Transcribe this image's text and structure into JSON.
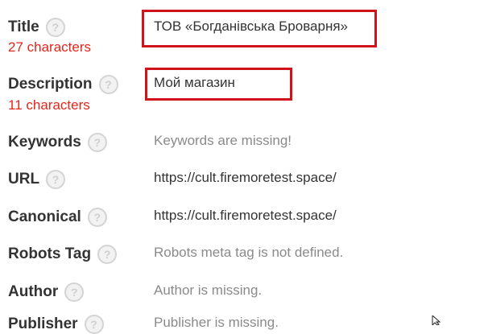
{
  "rows": [
    {
      "label": "Title",
      "count": "27 characters",
      "value": "ТОВ «Богданівська Броварня»",
      "status_color": "#e3261b"
    },
    {
      "label": "Description",
      "count": "11 characters",
      "value": "Мой магазин",
      "status_color": "#e3261b"
    },
    {
      "label": "Keywords",
      "value": "Keywords are missing!"
    },
    {
      "label": "URL",
      "value": "https://cult.firemoretest.space/"
    },
    {
      "label": "Canonical",
      "value": "https://cult.firemoretest.space/"
    },
    {
      "label": "Robots Tag",
      "value": "Robots meta tag is not defined."
    },
    {
      "label": "Author",
      "value": "Author is missing."
    },
    {
      "label": "Publisher",
      "value": "Publisher is missing."
    }
  ],
  "help_icon_glyph": "?",
  "colors": {
    "highlight_border": "#d0121c",
    "label": "#333333",
    "muted_value": "#8a8a8a"
  }
}
